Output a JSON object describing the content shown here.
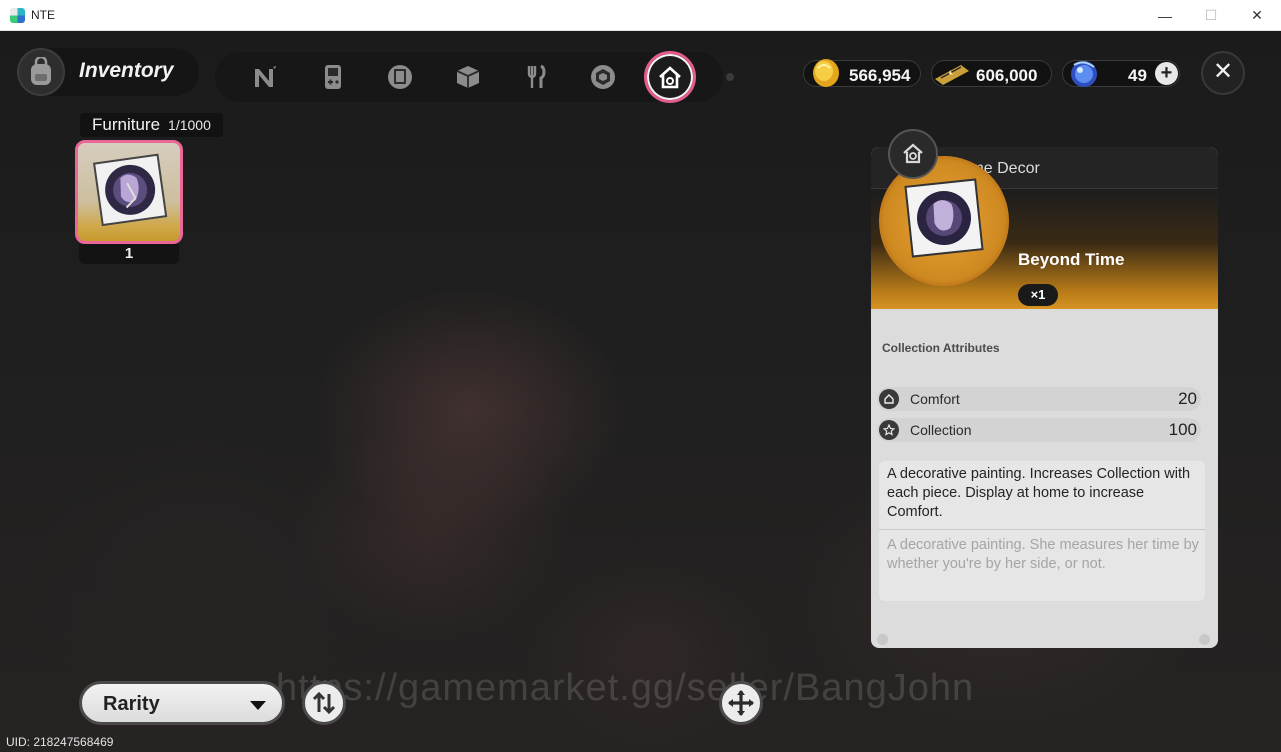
{
  "window": {
    "title": "NTE",
    "minimize_glyph": "—",
    "maximize_glyph": "☐",
    "close_glyph": "✕"
  },
  "header": {
    "title": "Inventory",
    "bag_icon": "backpack-icon",
    "tabs": [
      {
        "icon": "n-logo-icon",
        "active": false
      },
      {
        "icon": "handheld-console-icon",
        "active": false
      },
      {
        "icon": "book-icon",
        "active": false
      },
      {
        "icon": "box-icon",
        "active": false
      },
      {
        "icon": "fork-knife-icon",
        "active": false
      },
      {
        "icon": "cube-stamp-icon",
        "active": false
      },
      {
        "icon": "home-decor-icon",
        "active": true
      }
    ]
  },
  "currencies": [
    {
      "icon": "gold-coin-icon",
      "value": "566,954"
    },
    {
      "icon": "ticket-icon",
      "value": "606,000"
    },
    {
      "icon": "crystal-orb-icon",
      "value": "49"
    }
  ],
  "add_currency_label": "+",
  "close_label": "✕",
  "inventory": {
    "category_name": "Furniture",
    "capacity": "1/1000",
    "items": [
      {
        "quantity": "1",
        "rarity_color": "#ea6798",
        "selected": true
      }
    ]
  },
  "detail": {
    "category": "Home Decor",
    "category_icon": "house-gear-icon",
    "name": "Beyond Time",
    "stack": "×1",
    "attributes_title": "Collection Attributes",
    "attributes": [
      {
        "icon": "comfort-icon",
        "label": "Comfort",
        "value": "20"
      },
      {
        "icon": "star-icon",
        "label": "Collection",
        "value": "100"
      }
    ],
    "description": "A decorative painting. Increases Collection with each piece. Display at home to increase Comfort.",
    "flavor": "A decorative painting. She measures her time by whether you're by her side, or not."
  },
  "controls": {
    "sort_label": "Rarity",
    "sort_order_icon": "sort-arrows-icon",
    "dpad_icon": "dpad-icon"
  },
  "watermark": "https://gamemarket.gg/seller/BangJohn",
  "uid": "UID: 218247568469"
}
